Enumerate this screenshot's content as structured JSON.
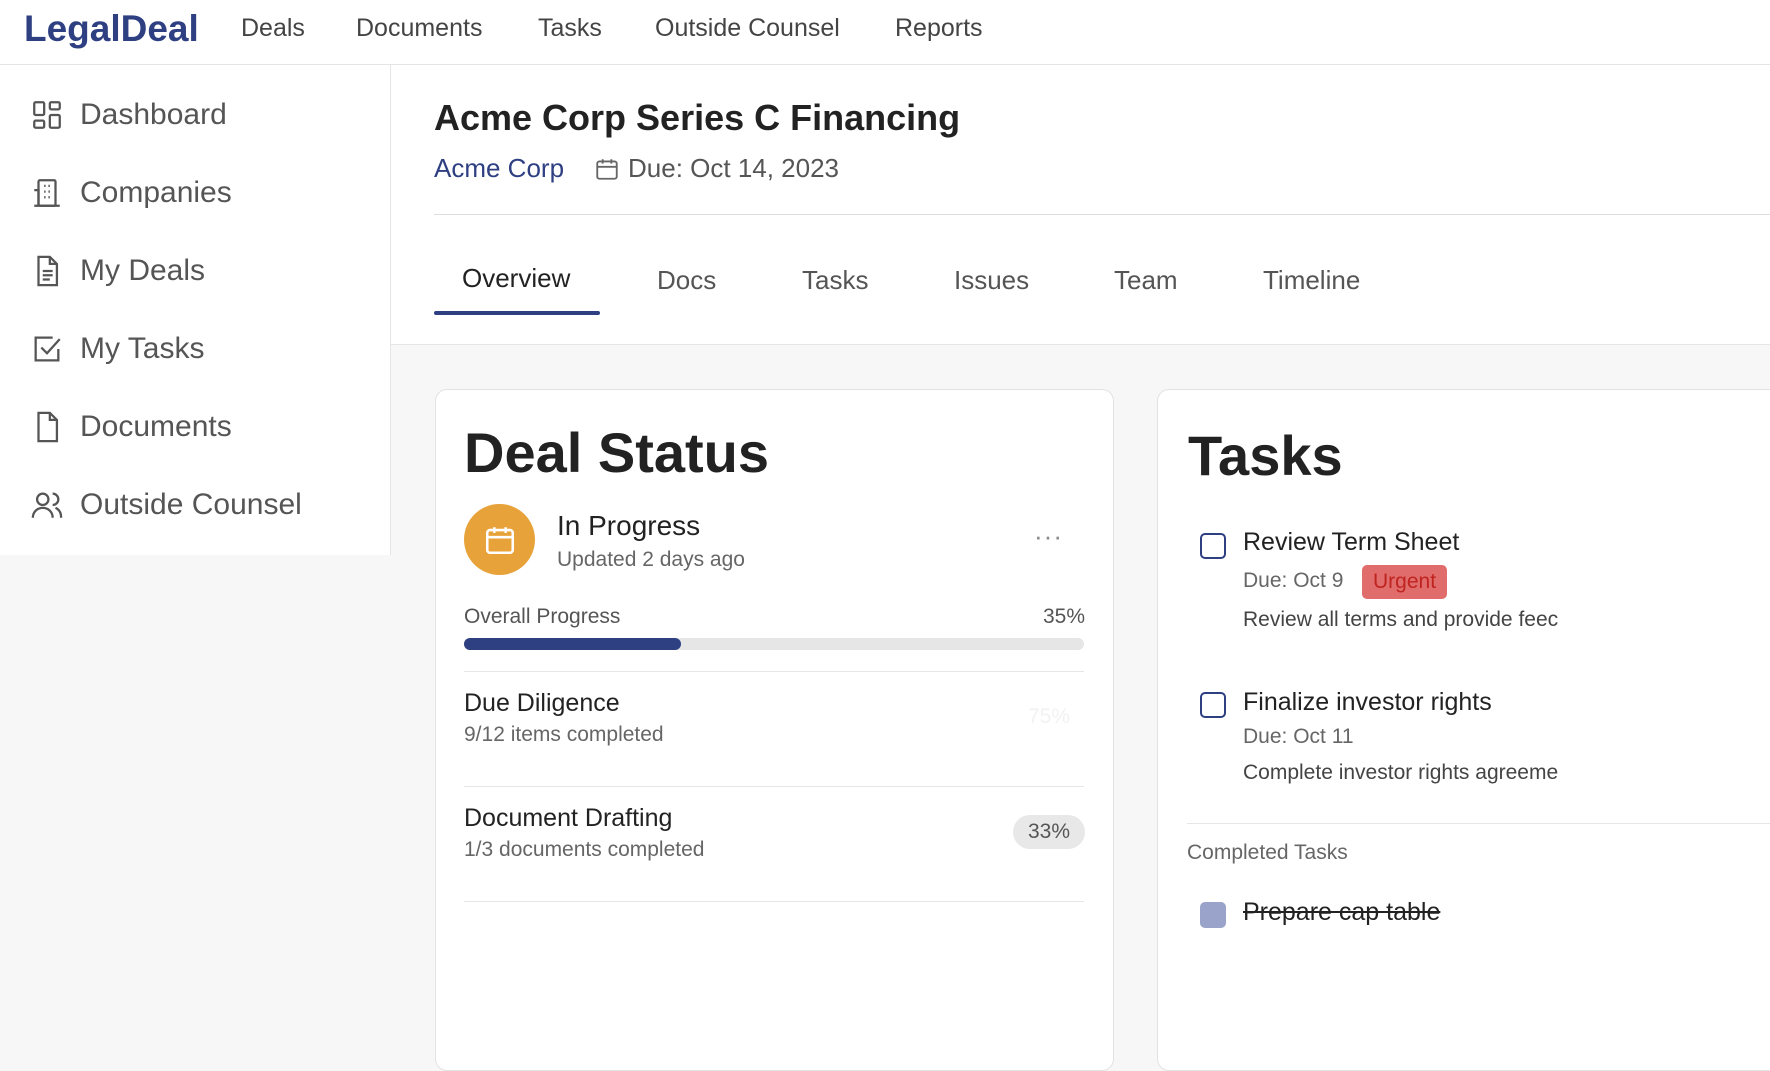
{
  "app": {
    "logo": "LegalDeal"
  },
  "topnav": [
    "Deals",
    "Documents",
    "Tasks",
    "Outside Counsel",
    "Reports"
  ],
  "sidebar": {
    "items": [
      {
        "label": "Dashboard",
        "icon": "dashboard-icon"
      },
      {
        "label": "Companies",
        "icon": "building-icon"
      },
      {
        "label": "My Deals",
        "icon": "document-lines-icon"
      },
      {
        "label": "My Tasks",
        "icon": "checkbox-icon"
      },
      {
        "label": "Documents",
        "icon": "file-icon"
      },
      {
        "label": "Outside Counsel",
        "icon": "users-icon"
      }
    ]
  },
  "deal": {
    "title": "Acme Corp Series C Financing",
    "company": "Acme Corp",
    "due": "Due: Oct 14, 2023"
  },
  "tabs": {
    "active": "Overview",
    "items": [
      "Overview",
      "Docs",
      "Tasks",
      "Issues",
      "Team",
      "Timeline"
    ]
  },
  "deal_status": {
    "title": "Deal Status",
    "status": "In Progress",
    "updated": "Updated 2 days ago",
    "more": "···",
    "overall_label": "Overall Progress",
    "overall_value": "35%",
    "overall_fraction": 0.35,
    "rows": [
      {
        "title": "Due Diligence",
        "sub": "9/12 items completed",
        "pill": "75%"
      },
      {
        "title": "Document Drafting",
        "sub": "1/3 documents completed",
        "pill": "33%"
      }
    ]
  },
  "tasks": {
    "title": "Tasks",
    "items": [
      {
        "title": "Review Term Sheet",
        "due": "Due: Oct 9",
        "badge": "Urgent",
        "desc": "Review all terms and provide feec"
      },
      {
        "title": "Finalize investor rights",
        "due": "Due: Oct 11",
        "desc": "Complete investor rights agreeme"
      }
    ],
    "completed_label": "Completed Tasks",
    "completed": [
      {
        "title": "Prepare cap table"
      }
    ]
  },
  "colors": {
    "brand": "#2e3f82",
    "status_orange": "#e8a23a",
    "urgent_bg": "#e06c6c",
    "urgent_text": "#c0241f"
  }
}
